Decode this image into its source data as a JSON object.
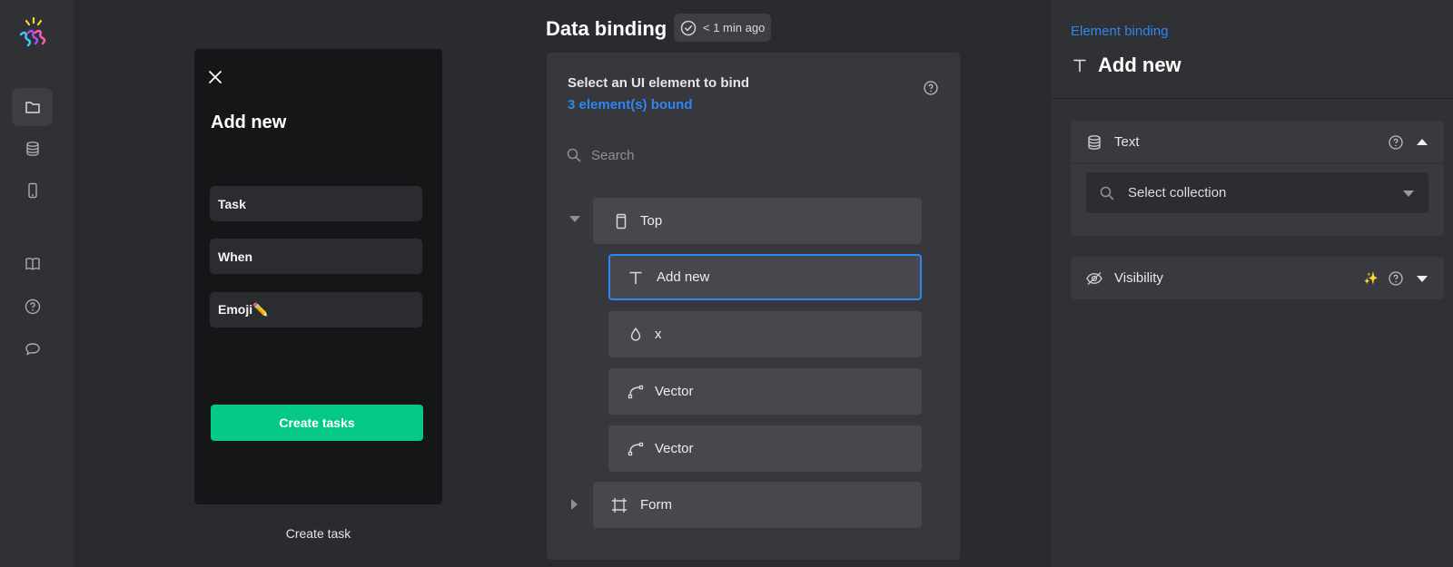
{
  "app": {
    "logo_icon": "confetti-logo-icon"
  },
  "rail": {
    "items": [
      {
        "icon": "folder-icon",
        "active": true
      },
      {
        "icon": "database-icon",
        "active": false
      },
      {
        "icon": "mobile-icon",
        "active": false
      },
      {
        "icon": "book-icon",
        "active": false
      },
      {
        "icon": "help-circle-icon",
        "active": false
      },
      {
        "icon": "chat-bubble-icon",
        "active": false
      }
    ]
  },
  "preview": {
    "screen_title": "Add new",
    "fields": [
      "Task",
      "When",
      "Emoji✏️"
    ],
    "cta_label": "Create tasks",
    "screen_caption": "Create task"
  },
  "header": {
    "title": "Data binding",
    "saved_status": "< 1 min ago"
  },
  "binding_panel": {
    "heading": "Select an UI element to bind",
    "bound_count": "3 element(s) bound",
    "search_placeholder": "Search",
    "tree": [
      {
        "label": "Top",
        "icon": "mobile-frame-icon",
        "level": 0,
        "expanded": true
      },
      {
        "label": "Add new",
        "icon": "text-icon",
        "level": 1,
        "selected": true
      },
      {
        "label": "x",
        "icon": "drop-icon",
        "level": 1
      },
      {
        "label": "Vector",
        "icon": "vector-path-icon",
        "level": 1
      },
      {
        "label": "Vector",
        "icon": "vector-path-icon",
        "level": 1
      },
      {
        "label": "Form",
        "icon": "frame-icon",
        "level": 0,
        "expanded": false
      }
    ]
  },
  "inspector": {
    "breadcrumb": "Element binding",
    "element_title": "Add new",
    "sections": {
      "text": {
        "label": "Text",
        "select_placeholder": "Select collection"
      },
      "visibility": {
        "label": "Visibility",
        "badge": "✨"
      }
    }
  },
  "colors": {
    "accent": "#2e86f0",
    "cta": "#06c988",
    "background": "#2a2b2f"
  }
}
